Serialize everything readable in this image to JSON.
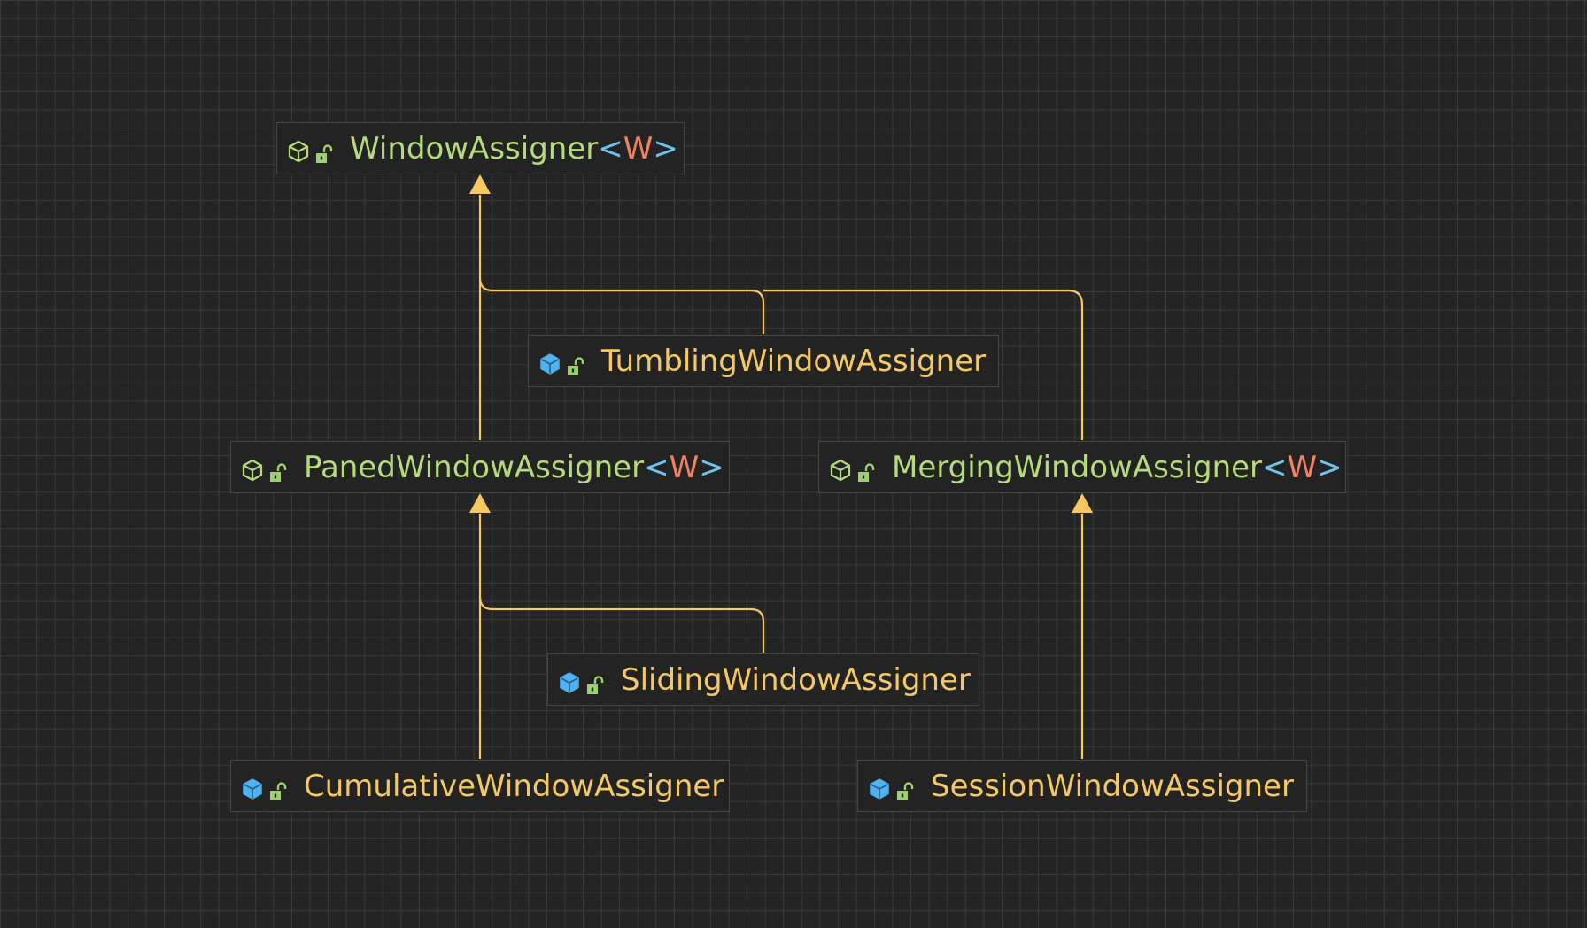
{
  "diagram": {
    "nodes": [
      {
        "id": "window-assigner",
        "kind": "interface",
        "name": "WindowAssigner",
        "type_param": "W"
      },
      {
        "id": "tumbling-window-assigner",
        "kind": "class",
        "name": "TumblingWindowAssigner",
        "type_param": null
      },
      {
        "id": "paned-window-assigner",
        "kind": "interface",
        "name": "PanedWindowAssigner",
        "type_param": "W"
      },
      {
        "id": "merging-window-assigner",
        "kind": "interface",
        "name": "MergingWindowAssigner",
        "type_param": "W"
      },
      {
        "id": "sliding-window-assigner",
        "kind": "class",
        "name": "SlidingWindowAssigner",
        "type_param": null
      },
      {
        "id": "cumulative-window-assigner",
        "kind": "class",
        "name": "CumulativeWindowAssigner",
        "type_param": null
      },
      {
        "id": "session-window-assigner",
        "kind": "class",
        "name": "SessionWindowAssigner",
        "type_param": null
      }
    ],
    "edges": [
      {
        "from": "tumbling-window-assigner",
        "to": "window-assigner"
      },
      {
        "from": "paned-window-assigner",
        "to": "window-assigner"
      },
      {
        "from": "merging-window-assigner",
        "to": "window-assigner"
      },
      {
        "from": "sliding-window-assigner",
        "to": "paned-window-assigner"
      },
      {
        "from": "cumulative-window-assigner",
        "to": "paned-window-assigner"
      },
      {
        "from": "session-window-assigner",
        "to": "merging-window-assigner"
      }
    ],
    "symbols": {
      "lt": "<",
      "gt": ">"
    },
    "colors": {
      "background": "#242424",
      "grid": "#3a3a3a",
      "edge": "#f6c765",
      "interface_name": "#b4db7c",
      "class_name": "#f4c867",
      "angle_bracket": "#6cc4ef",
      "type_param": "#ee8262",
      "class_icon": "#4fb1ef",
      "access_icon": "#9bd36b"
    },
    "icons": {
      "interface": "interface-icon",
      "class": "class-icon",
      "access": "unlocked-public-icon"
    }
  }
}
